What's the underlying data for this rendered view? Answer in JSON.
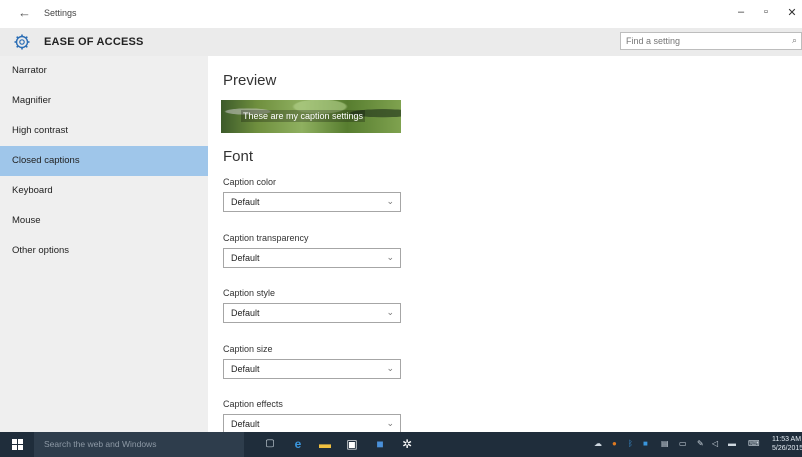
{
  "window": {
    "back_glyph": "←",
    "title": "Settings",
    "minimize_glyph": "–",
    "maximize_glyph": "▫",
    "close_glyph": "✕"
  },
  "header": {
    "icon": "gear-icon",
    "title": "EASE OF ACCESS",
    "search_placeholder": "Find a setting",
    "search_icon": "search-icon"
  },
  "sidebar": {
    "items": [
      {
        "label": "Narrator",
        "active": false
      },
      {
        "label": "Magnifier",
        "active": false
      },
      {
        "label": "High contrast",
        "active": false
      },
      {
        "label": "Closed captions",
        "active": true
      },
      {
        "label": "Keyboard",
        "active": false
      },
      {
        "label": "Mouse",
        "active": false
      },
      {
        "label": "Other options",
        "active": false
      }
    ]
  },
  "main": {
    "preview_heading": "Preview",
    "preview_caption": "These are my caption settings",
    "font_heading": "Font",
    "fields": [
      {
        "label": "Caption color",
        "value": "Default"
      },
      {
        "label": "Caption transparency",
        "value": "Default"
      },
      {
        "label": "Caption style",
        "value": "Default"
      },
      {
        "label": "Caption size",
        "value": "Default"
      },
      {
        "label": "Caption effects",
        "value": "Default"
      }
    ]
  },
  "taskbar": {
    "search_placeholder": "Search the web and Windows",
    "clock_time": "11:53 AM",
    "clock_date": "5/26/2015"
  },
  "colors": {
    "active_nav": "#9fc6ea",
    "sidebar_bg": "#efefef",
    "header_bg": "#ebebeb",
    "taskbar_bg": "#1f2d3b",
    "accent": "#2a6db5"
  }
}
